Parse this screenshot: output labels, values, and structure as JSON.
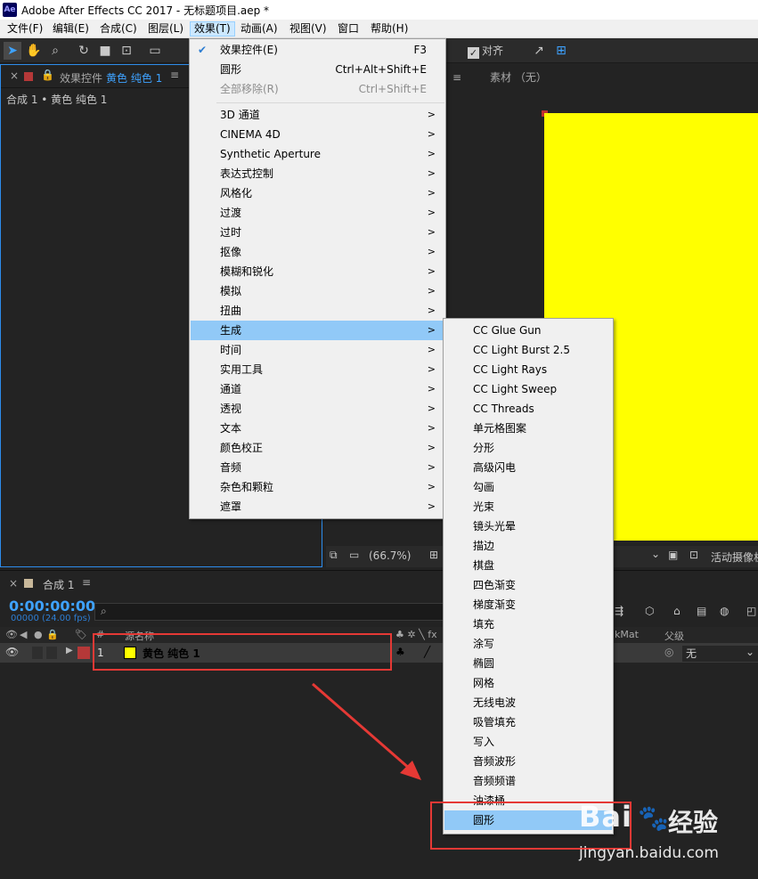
{
  "app": {
    "logo": "Ae",
    "title": "Adobe After Effects CC 2017 - 无标题项目.aep *"
  },
  "menubar": [
    "文件(F)",
    "编辑(E)",
    "合成(C)",
    "图层(L)",
    "效果(T)",
    "动画(A)",
    "视图(V)",
    "窗口",
    "帮助(H)"
  ],
  "toolbar": {
    "snap_label": "对齐"
  },
  "effect_controls": {
    "tab_label": "效果控件",
    "layer_name": "黄色 纯色 1",
    "breadcrumb": "合成 1 • 黄色 纯色 1"
  },
  "viewer": {
    "footage_tab": "素材 （无）",
    "zoom": "(66.7%)",
    "camera": "活动摄像机"
  },
  "timeline": {
    "comp_tab": "合成 1",
    "timecode": "0:00:00:00",
    "fps": "00000 (24.00 fps)",
    "search_icon": "⌕",
    "col_num": "#",
    "col_source": "源名称",
    "col_mat": "kMat",
    "col_parent": "父级",
    "layer_index": "1",
    "layer_name": "黄色 纯色 1",
    "parent_value": "无"
  },
  "effects_menu": {
    "top": [
      {
        "label": "效果控件(E)",
        "shortcut": "F3",
        "checked": true
      },
      {
        "label": "圆形",
        "shortcut": "Ctrl+Alt+Shift+E"
      },
      {
        "label": "全部移除(R)",
        "shortcut": "Ctrl+Shift+E",
        "disabled": true
      }
    ],
    "categories": [
      "3D 通道",
      "CINEMA 4D",
      "Synthetic Aperture",
      "表达式控制",
      "风格化",
      "过渡",
      "过时",
      "抠像",
      "模糊和锐化",
      "模拟",
      "扭曲",
      "生成",
      "时间",
      "实用工具",
      "通道",
      "透视",
      "文本",
      "颜色校正",
      "音频",
      "杂色和颗粒",
      "遮罩"
    ],
    "highlighted": "生成"
  },
  "generate_submenu": [
    "CC Glue Gun",
    "CC Light Burst 2.5",
    "CC Light Rays",
    "CC Light Sweep",
    "CC Threads",
    "单元格图案",
    "分形",
    "高级闪电",
    "勾画",
    "光束",
    "镜头光晕",
    "描边",
    "棋盘",
    "四色渐变",
    "梯度渐变",
    "填充",
    "涂写",
    "椭圆",
    "网格",
    "无线电波",
    "吸管填充",
    "写入",
    "音频波形",
    "音频频谱",
    "油漆桶",
    "圆形"
  ],
  "watermark": {
    "brand": "Bai",
    "brand2": "经验",
    "url": "jingyan.baidu.com"
  },
  "colors": {
    "accent": "#2d8ceb",
    "menu_highlight": "#91c9f7",
    "solid": "#ffff00",
    "annotation": "#e53935"
  }
}
